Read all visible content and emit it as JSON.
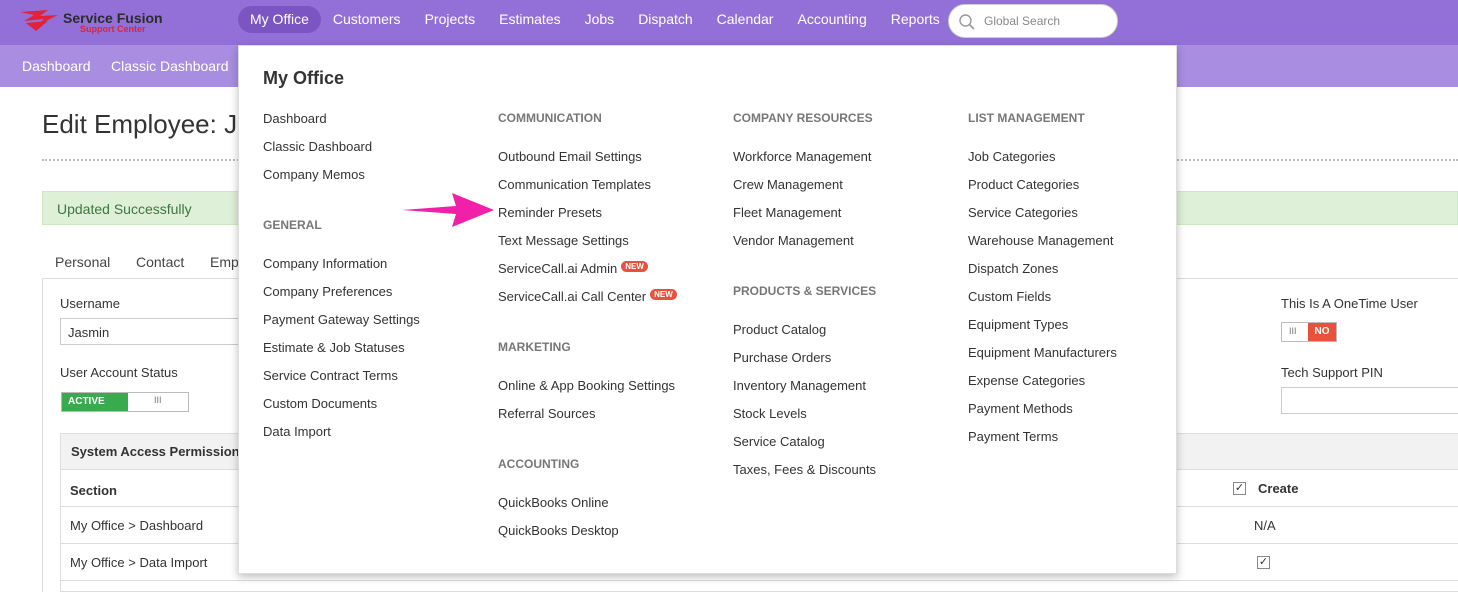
{
  "brand": {
    "name": "Service Fusion",
    "subtitle": "Support Center",
    "primary": "#9370d8",
    "subbar": "#a98de0"
  },
  "nav": [
    {
      "label": "My Office",
      "active": true
    },
    {
      "label": "Customers"
    },
    {
      "label": "Projects"
    },
    {
      "label": "Estimates"
    },
    {
      "label": "Jobs"
    },
    {
      "label": "Dispatch"
    },
    {
      "label": "Calendar"
    },
    {
      "label": "Accounting"
    },
    {
      "label": "Reports"
    }
  ],
  "search": {
    "placeholder": "Global Search"
  },
  "subnav": [
    {
      "label": "Dashboard"
    },
    {
      "label": "Classic Dashboard"
    }
  ],
  "page": {
    "title": "Edit Employee: Jasmin",
    "alert": "Updated Successfully",
    "tabs": [
      {
        "label": "Personal"
      },
      {
        "label": "Contact"
      },
      {
        "label": "Employment"
      }
    ],
    "username_label": "Username",
    "username_value": "Jasmin",
    "account_status_label": "User Account Status",
    "account_status_value": "ACTIVE",
    "onetime_label": "This Is A OneTime User",
    "onetime_value": "NO",
    "pin_label": "Tech Support PIN",
    "permissions": {
      "title": "System Access Permissions",
      "col_section": "Section",
      "col_create": "Create",
      "rows": [
        {
          "section": "My Office > Dashboard",
          "create": "N/A"
        },
        {
          "section": "My Office > Data Import",
          "create": "checked"
        }
      ]
    }
  },
  "dropdown": {
    "title": "My Office",
    "col1": {
      "links": [
        "Dashboard",
        "Classic Dashboard",
        "Company Memos"
      ],
      "general_title": "GENERAL",
      "general": [
        "Company Information",
        "Company Preferences",
        "Payment Gateway Settings",
        "Estimate & Job Statuses",
        "Service Contract Terms",
        "Custom Documents",
        "Data Import"
      ]
    },
    "col2": {
      "communication_title": "COMMUNICATION",
      "communication": [
        "Outbound Email Settings",
        "Communication Templates",
        "Reminder Presets",
        "Text Message Settings",
        "ServiceCall.ai Admin",
        "ServiceCall.ai Call Center"
      ],
      "new_badge": "NEW",
      "marketing_title": "MARKETING",
      "marketing": [
        "Online & App Booking Settings",
        "Referral Sources"
      ],
      "accounting_title": "ACCOUNTING",
      "accounting": [
        "QuickBooks Online",
        "QuickBooks Desktop"
      ]
    },
    "col3": {
      "resources_title": "COMPANY RESOURCES",
      "resources": [
        "Workforce Management",
        "Crew Management",
        "Fleet Management",
        "Vendor Management"
      ],
      "products_title": "PRODUCTS & SERVICES",
      "products": [
        "Product Catalog",
        "Purchase Orders",
        "Inventory Management",
        "Stock Levels",
        "Service Catalog",
        "Taxes, Fees & Discounts"
      ]
    },
    "col4": {
      "list_title": "LIST MANAGEMENT",
      "list": [
        "Job Categories",
        "Product Categories",
        "Service Categories",
        "Warehouse Management",
        "Dispatch Zones",
        "Custom Fields",
        "Equipment Types",
        "Equipment Manufacturers",
        "Expense Categories",
        "Payment Methods",
        "Payment Terms"
      ]
    }
  },
  "annotation": {
    "icon": "pointer-arrow-icon",
    "color": "#f020a8"
  }
}
